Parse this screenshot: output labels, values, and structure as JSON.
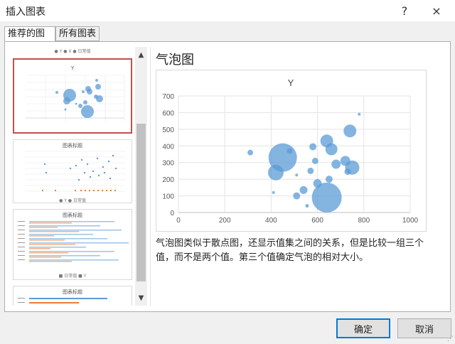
{
  "window": {
    "title": "插入图表",
    "help": "?",
    "close": "×"
  },
  "tabs": [
    {
      "label": "推荐的图表"
    },
    {
      "label": "所有图表"
    }
  ],
  "thumbnails": [
    {
      "title": "Y",
      "legend": "● Y  ● X  ● 日常值"
    },
    {
      "title": "图表标题",
      "legend": "● Y  ● 日常值"
    },
    {
      "title": "图表标题",
      "legend": "■ 日常值  ■ Y"
    },
    {
      "title": "图表标题",
      "legend": ""
    }
  ],
  "preview": {
    "title": "气泡图",
    "description": "气泡图类似于散点图，还显示值集之间的关系，但是比较一组三个值，而不是两个值。第三个值确定气泡的相对大小。"
  },
  "buttons": {
    "ok": "确定",
    "cancel": "取消"
  },
  "chart_data": {
    "type": "bubble",
    "title": "Y",
    "xlim": [
      0,
      1000
    ],
    "ylim": [
      0,
      700
    ],
    "x_ticks": [
      "0",
      "200",
      "400",
      "600",
      "800",
      "1000"
    ],
    "y_ticks": [
      "0",
      "100",
      "200",
      "300",
      "400",
      "500",
      "600",
      "700"
    ],
    "grid": true,
    "color": "#5b9bd5",
    "points": [
      {
        "x": 450,
        "y": 330,
        "size": 40
      },
      {
        "x": 640,
        "y": 90,
        "size": 42
      },
      {
        "x": 420,
        "y": 240,
        "size": 22
      },
      {
        "x": 640,
        "y": 430,
        "size": 18
      },
      {
        "x": 740,
        "y": 490,
        "size": 18
      },
      {
        "x": 660,
        "y": 380,
        "size": 17
      },
      {
        "x": 750,
        "y": 270,
        "size": 20
      },
      {
        "x": 720,
        "y": 310,
        "size": 14
      },
      {
        "x": 680,
        "y": 290,
        "size": 13
      },
      {
        "x": 600,
        "y": 175,
        "size": 12
      },
      {
        "x": 650,
        "y": 200,
        "size": 10
      },
      {
        "x": 540,
        "y": 135,
        "size": 11
      },
      {
        "x": 510,
        "y": 100,
        "size": 10
      },
      {
        "x": 570,
        "y": 250,
        "size": 9
      },
      {
        "x": 590,
        "y": 310,
        "size": 9
      },
      {
        "x": 730,
        "y": 245,
        "size": 9
      },
      {
        "x": 580,
        "y": 395,
        "size": 10
      },
      {
        "x": 480,
        "y": 370,
        "size": 8
      },
      {
        "x": 310,
        "y": 360,
        "size": 8
      },
      {
        "x": 510,
        "y": 225,
        "size": 4
      },
      {
        "x": 410,
        "y": 120,
        "size": 4
      },
      {
        "x": 555,
        "y": 40,
        "size": 5
      },
      {
        "x": 780,
        "y": 590,
        "size": 4
      }
    ]
  }
}
